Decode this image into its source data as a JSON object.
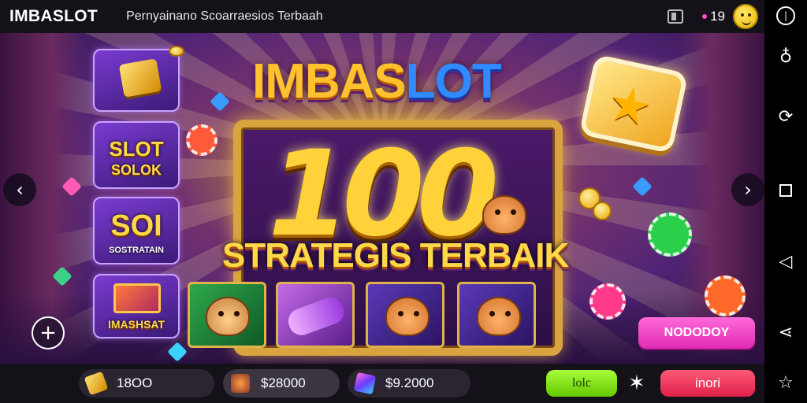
{
  "header": {
    "brand": "IMBASLOT",
    "subtitle": "Pernyainano Scoarraesios Terbaah",
    "notification_count": "19"
  },
  "stage": {
    "logo_main": "IMBAS",
    "logo_accent": "LOT",
    "big_number": "100",
    "strapline": "STRATEGIS TERBAIK",
    "thumbnails": [
      {
        "line1": "",
        "line2": ""
      },
      {
        "line1": "SLOT",
        "line2": "SOLOK"
      },
      {
        "line1": "SOI",
        "line2": "SOSTRATAIN"
      },
      {
        "line1": "IMASHSAT",
        "line2": ""
      }
    ],
    "promo_button": "NODODOY",
    "nav_prev": "‹",
    "nav_next": "›",
    "fab": "+"
  },
  "bottom": {
    "stat1": "18OO",
    "stat2": "$28000",
    "stat3": "$9.2000",
    "green_button": "lolc",
    "red_button": "inori"
  },
  "icons": [
    "power-icon",
    "bulb-icon",
    "rotate-icon",
    "square-icon",
    "back-icon",
    "share-icon",
    "star-icon"
  ],
  "colors": {
    "accent_gold": "#ffc12e",
    "accent_blue": "#2f8bff",
    "promo_pink": "#e02bb4",
    "button_green": "#64c800",
    "button_red": "#e0204a"
  }
}
